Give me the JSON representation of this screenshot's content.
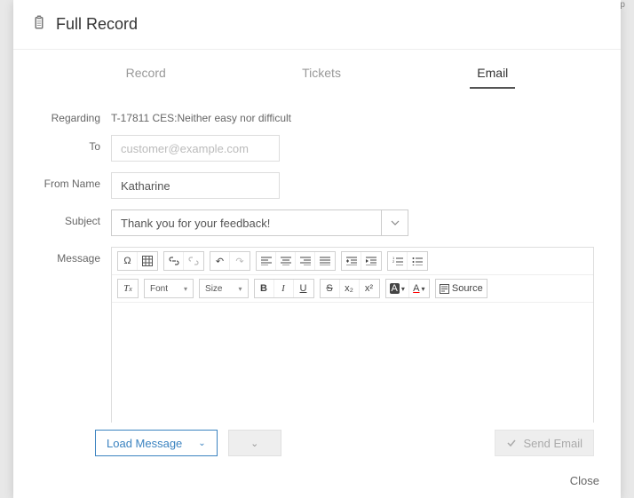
{
  "bg_hint": "Page Up",
  "modal": {
    "title": "Full Record",
    "icon": "clipboard-icon"
  },
  "tabs": {
    "record": "Record",
    "tickets": "Tickets",
    "email": "Email",
    "active": "email"
  },
  "form": {
    "regarding_label": "Regarding",
    "regarding_value": "T-17811 CES:Neither easy nor difficult",
    "to_label": "To",
    "to_placeholder": "customer@example.com",
    "to_value": "",
    "from_label": "From Name",
    "from_value": "Katharine",
    "subject_label": "Subject",
    "subject_value": "Thank you for your feedback!",
    "message_label": "Message"
  },
  "toolbar": {
    "omega": "Ω",
    "table": "⊞",
    "link": "🔗",
    "unlink": "⊘",
    "undo": "↶",
    "redo": "↷",
    "align_left": "≡",
    "align_center": "≡",
    "align_right": "≡",
    "align_justify": "≡",
    "outdent": "⇤",
    "indent": "⇥",
    "list_num": "≣",
    "list_bullet": "≣",
    "clear_format": "Tx",
    "font_label": "Font",
    "size_label": "Size",
    "bold": "B",
    "italic": "I",
    "underline": "U",
    "strike": "S",
    "subscript": "x₂",
    "superscript": "x²",
    "bgcolor": "A",
    "textcolor": "A",
    "source": "Source"
  },
  "actions": {
    "load_message": "Load Message",
    "send_email": "Send Email",
    "close": "Close"
  }
}
